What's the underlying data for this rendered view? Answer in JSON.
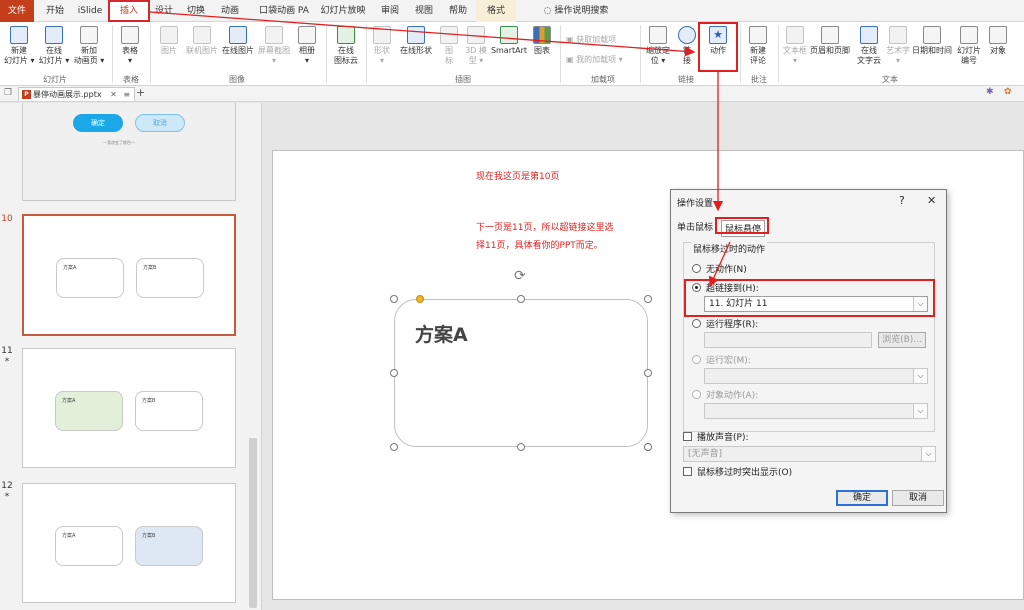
{
  "ribbon_tabs": [
    "文件",
    "开始",
    "iSlide",
    "插入",
    "设计",
    "切换",
    "动画",
    "口袋动画 PA",
    "幻灯片放映",
    "审阅",
    "视图",
    "帮助",
    "格式"
  ],
  "tell_me": "操作说明搜索",
  "ribbon": {
    "new_slide": "新建\n幻灯片 ▾",
    "online_slide": "在线\n幻灯片 ▾",
    "new_anim_page": "新加\n动画页 ▾",
    "table": "表格\n▾",
    "picture": "图片",
    "online_pic": "联机图片",
    "online_image": "在线图片",
    "screenshot": "屏幕截图\n▾",
    "album": "相册\n▾",
    "online_icon_cloud": "在线\n图标云",
    "shapes": "形状\n▾",
    "online_shapes": "在线形状",
    "icons": "图\n标",
    "model3d": "3D 模\n型 ▾",
    "smartart": "SmartArt",
    "chart": "图表",
    "get_addins": "获取加载项",
    "my_addins": "我的加载项 ▾",
    "zoom": "缩放定\n位 ▾",
    "link": "链\n接",
    "action": "动作",
    "new_comment": "新建\n评论",
    "textbox": "文本框\n▾",
    "header_footer": "页眉和页脚",
    "online_text_cloud": "在线\n文字云",
    "wordart": "艺术字\n▾",
    "date_time": "日期和时间",
    "slide_number": "幻灯片\n编号",
    "object": "对象"
  },
  "groups": [
    "幻灯片",
    "表格",
    "图像",
    "插图",
    "加载项",
    "链接",
    "批注",
    "文本"
  ],
  "doc_tab": "暴停动画展示.pptx",
  "thumbnails": {
    "slide9": {
      "confirm": "确定",
      "cancel": "取消",
      "caption": "—我改变了颜色—"
    },
    "slide10": {
      "num": "10",
      "a": "方案A",
      "b": "方案B"
    },
    "slide11": {
      "num": "11",
      "star": "*",
      "a": "方案A",
      "b": "方案B"
    },
    "slide12": {
      "num": "12",
      "star": "*",
      "a": "方案A",
      "b": "方案B"
    }
  },
  "slide": {
    "note1": "现在我这页是第10页",
    "note2a": "下一页是11页，所以超链接这里选",
    "note2b": "择11页，具体看你的PPT而定。",
    "shape_title": "方案A"
  },
  "dialog": {
    "title": "操作设置",
    "help": "?",
    "close": "✕",
    "tab_click": "单击鼠标",
    "tab_hover": "鼠标悬停",
    "section": "鼠标移过时的动作",
    "none": "无动作(N)",
    "hyperlink": "超链接到(H):",
    "hyperlink_value": "11. 幻灯片 11",
    "run_program": "运行程序(R):",
    "browse": "浏览(B)...",
    "run_macro": "运行宏(M):",
    "object_action": "对象动作(A):",
    "play_sound": "播放声音(P):",
    "sound_value": "[无声音]",
    "highlight": "鼠标移过时突出显示(O)",
    "ok": "确定",
    "cancel": "取消"
  }
}
